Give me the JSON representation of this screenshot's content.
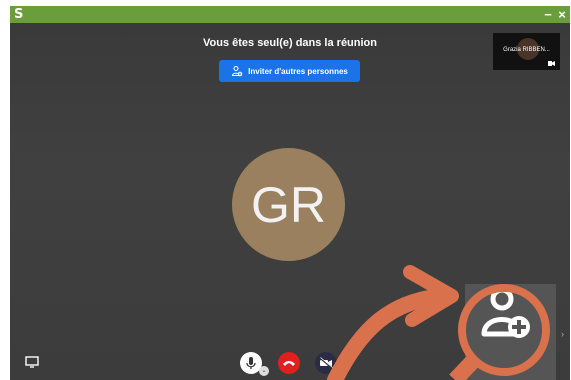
{
  "titlebar": {
    "logo": "S",
    "minimize_glyph": "−",
    "close_glyph": "×"
  },
  "meeting": {
    "alone_message": "Vous êtes seul(e) dans la réunion",
    "invite_button_label": "Inviter d'autres personnes",
    "participant_initials": "GR",
    "self_view_name": "Grazia RIBBEN..."
  },
  "colors": {
    "titlebar": "#6a9e3a",
    "invite_button": "#1a73e8",
    "avatar": "#9b8060",
    "hangup": "#e02020",
    "annotation": "#d9714d"
  },
  "icons": {
    "invite": "add-person-icon",
    "screen_share": "screen-share-icon",
    "microphone": "microphone-icon",
    "hangup": "phone-hangup-icon",
    "camera": "camera-off-icon",
    "annotation": "add-person-icon"
  }
}
